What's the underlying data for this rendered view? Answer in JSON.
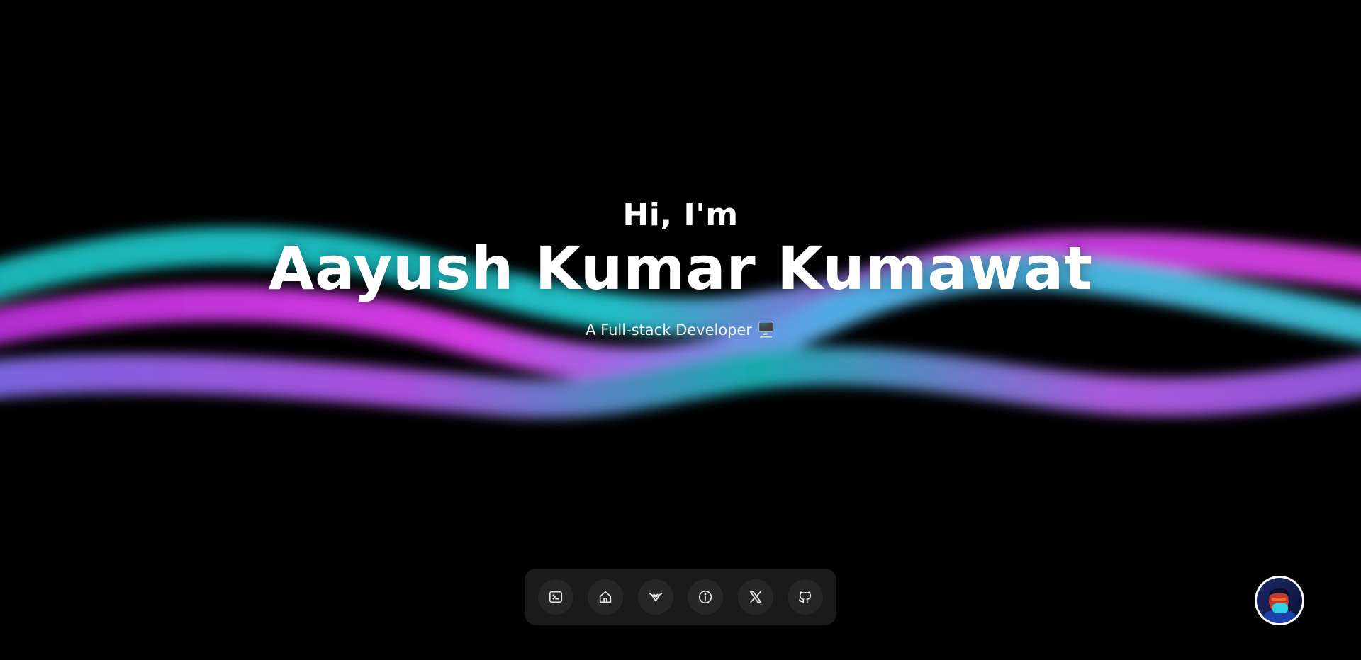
{
  "hero": {
    "greeting": "Hi, I'm",
    "name": "Aayush Kumar Kumawat",
    "tagline": "A Full-stack Developer 🖥️"
  },
  "dock": {
    "items": [
      {
        "icon": "terminal-icon"
      },
      {
        "icon": "home-icon"
      },
      {
        "icon": "portfolio-logo-icon"
      },
      {
        "icon": "info-icon"
      },
      {
        "icon": "x-logo-icon"
      },
      {
        "icon": "github-icon"
      }
    ]
  },
  "colors": {
    "background": "#000000",
    "teal": "#18c6c4",
    "magenta": "#d43be6",
    "blue": "#5aa8ee",
    "violet": "#a45ae8",
    "dock": "#1a1a1a"
  }
}
